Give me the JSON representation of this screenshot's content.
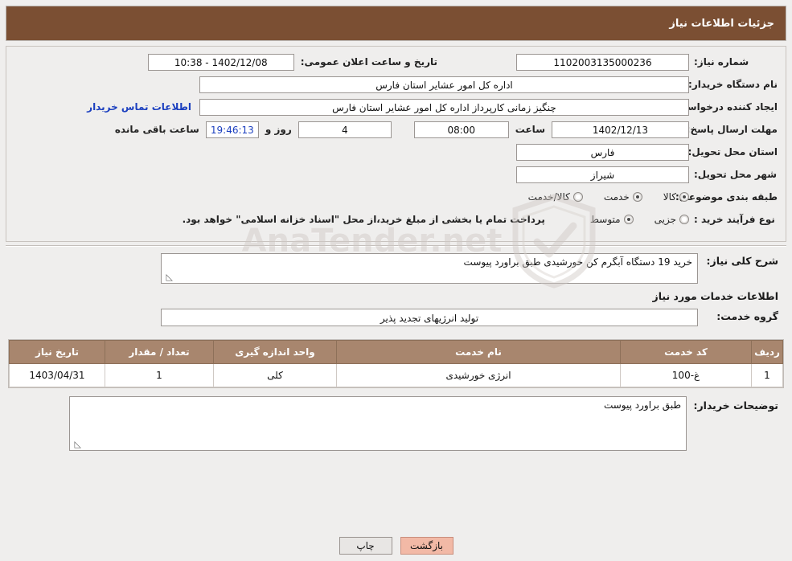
{
  "header": {
    "title": "جزئیات اطلاعات نیاز"
  },
  "form": {
    "need_number_label": "شماره نیاز:",
    "need_number_value": "1102003135000236",
    "announce_datetime_label": "تاریخ و ساعت اعلان عمومی:",
    "announce_datetime_value": "1402/12/08 - 10:38",
    "buyer_org_label": "نام دستگاه خریدار:",
    "buyer_org_value": "اداره کل امور عشایر استان فارس",
    "requester_label": "ایجاد کننده درخواست:",
    "requester_value": "چنگیز زمانی کارپرداز اداره کل امور عشایر استان فارس",
    "contact_link": "اطلاعات تماس خریدار",
    "deadline_label": "مهلت ارسال پاسخ: تا تاریخ:",
    "deadline_date": "1402/12/13",
    "hour_label": "ساعت",
    "deadline_hour": "08:00",
    "days_value": "4",
    "days_label": "روز و",
    "remaining_time": "19:46:13",
    "remaining_label": "ساعت باقی مانده",
    "province_label": "استان محل تحویل:",
    "province_value": "فارس",
    "city_label": "شهر محل تحویل:",
    "city_value": "شیراز",
    "category_label": "طبقه بندی موضوعی:",
    "category_options": [
      {
        "label": "کالا",
        "checked": true
      },
      {
        "label": "خدمت",
        "checked": false
      },
      {
        "label": "کالا/خدمت",
        "checked": false
      }
    ],
    "process_label": "نوع فرآیند خرید :",
    "process_options": [
      {
        "label": "جزیی",
        "checked": false
      },
      {
        "label": "متوسط",
        "checked": true
      }
    ],
    "payment_note": "پرداخت تمام یا بخشی از مبلغ خرید،از محل \"اسناد خزانه اسلامی\" خواهد بود."
  },
  "summary": {
    "label": "شرح کلی نیاز:",
    "value": "خرید 19 دستگاه آبگرم کن خورشیدی طبق براورد پیوست"
  },
  "services": {
    "section_title": "اطلاعات خدمات مورد نیاز",
    "group_label": "گروه خدمت:",
    "group_value": "تولید انرژیهای تجدید پذیر",
    "columns": [
      "ردیف",
      "کد خدمت",
      "نام خدمت",
      "واحد اندازه گیری",
      "تعداد / مقدار",
      "تاریخ نیاز"
    ],
    "rows": [
      {
        "row": "1",
        "code": "غ-100",
        "name": "انرژی خورشیدی",
        "unit": "کلی",
        "qty": "1",
        "date": "1403/04/31"
      }
    ]
  },
  "buyer_notes": {
    "label": "توضیحات خریدار:",
    "value": "طبق براورد پیوست"
  },
  "buttons": {
    "print": "چاپ",
    "back": "بازگشت"
  },
  "watermark": {
    "text": "AnaTender.net"
  }
}
